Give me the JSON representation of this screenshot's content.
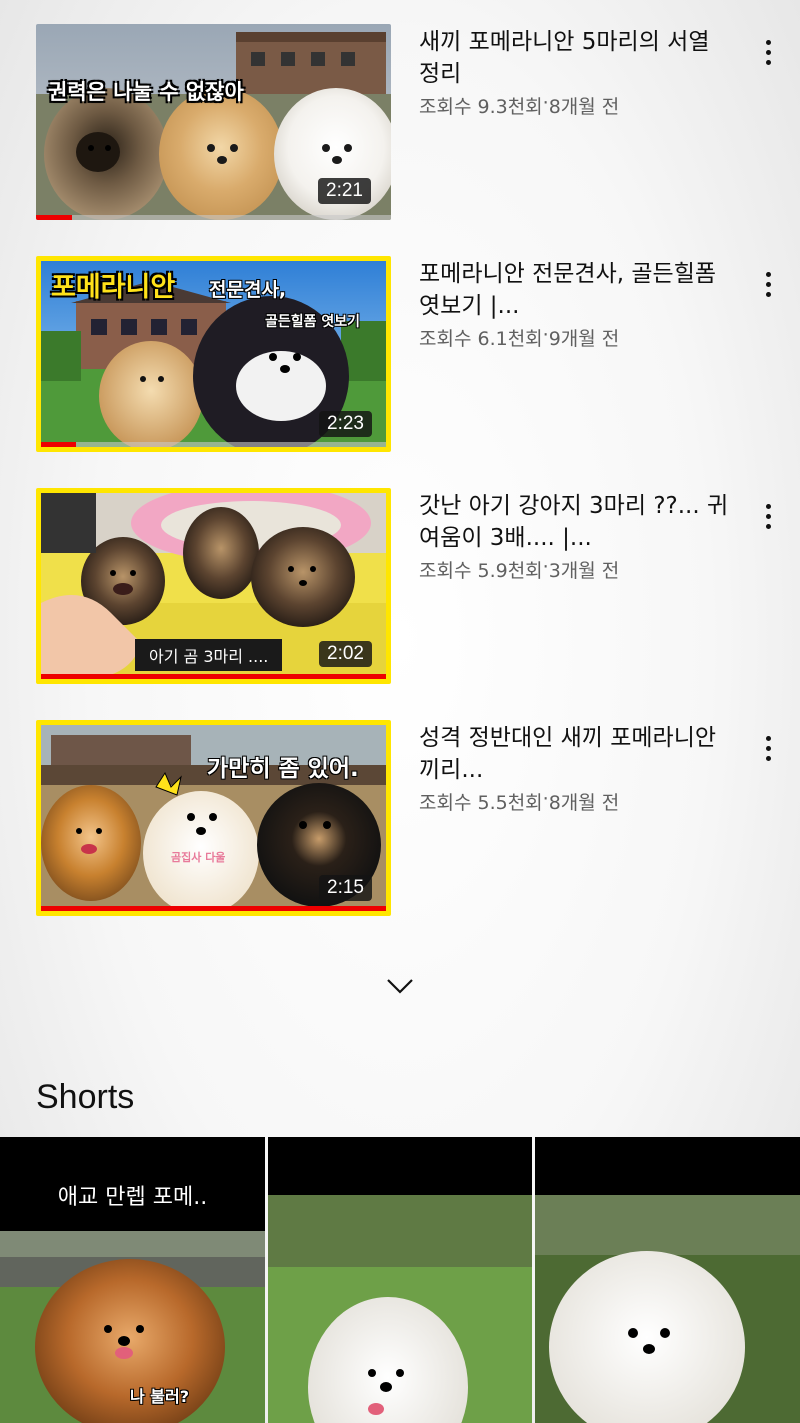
{
  "videos": [
    {
      "title": "새끼 포메라니안 5마리의 서열정리",
      "views": "조회수 9.3천회",
      "separator": " · ",
      "age": "8개월 전",
      "duration": "2:21",
      "thumb_caption": "권력은 나눌 수 없잖아",
      "progress": 0.1
    },
    {
      "title": "포메라니안 전문견사, 골든힐폼 엿보기  |...",
      "views": "조회수 6.1천회",
      "separator": " · ",
      "age": "9개월 전",
      "duration": "2:23",
      "thumb_caption": "포메라니안",
      "thumb_caption_2": "전문견사,",
      "thumb_caption_3": "골든힐폼 엿보기",
      "progress": 0.1
    },
    {
      "title": "갓난 아기 강아지  3마리 ??...   귀여움이 3배....   |...",
      "views": "조회수 5.9천회",
      "separator": " · ",
      "age": "3개월 전",
      "duration": "2:02",
      "thumb_caption": "아기  곰   3마리 ....",
      "progress": 1.0
    },
    {
      "title": "성격 정반대인 새끼 포메라니안 끼리...",
      "views": "조회수 5.5천회",
      "separator": " · ",
      "age": "8개월 전",
      "duration": "2:15",
      "thumb_caption": "가만히 좀 있어.",
      "thumb_caption_2": "곰집사 다울",
      "progress": 1.0
    }
  ],
  "shorts": {
    "heading": "Shorts",
    "items": [
      {
        "overlay": "애교 만렙 포메..",
        "sticker": "나 불러?"
      },
      {
        "overlay": ""
      },
      {
        "overlay": ""
      }
    ]
  },
  "icons": {
    "menu": "more-vert-icon",
    "expand": "chevron-down-icon"
  },
  "colors": {
    "progress": "#ee0000",
    "thumb_border_yellow": "#ffe600",
    "meta_text": "#606060"
  }
}
